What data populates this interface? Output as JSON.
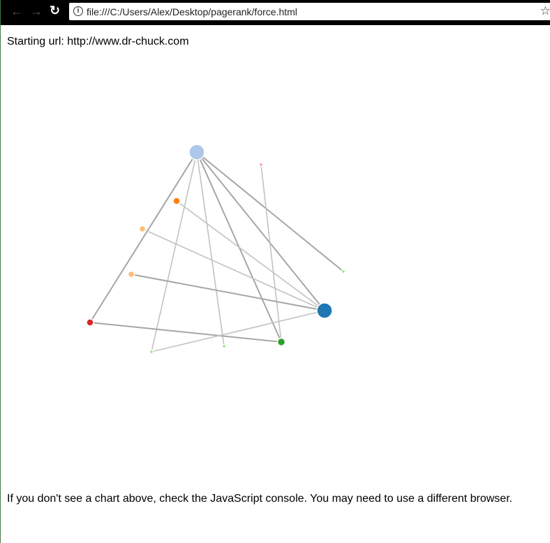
{
  "browser": {
    "url": "file:///C:/Users/Alex/Desktop/pagerank/force.html",
    "back_icon": "arrow-left-icon",
    "forward_icon": "arrow-right-icon",
    "reload_icon": "reload-icon",
    "info_icon": "info-icon",
    "bookmark_icon": "star-icon"
  },
  "page": {
    "starting_url_text": "Starting url: http://www.dr-chuck.com",
    "footer_text": "If you don't see a chart above, check the JavaScript console. You may need to use a different browser."
  },
  "graph": {
    "nodes": [
      {
        "color": "#aec7e8",
        "rank": 11
      },
      {
        "color": "#ff9896",
        "rank": 2.5
      },
      {
        "color": "#ff7f0e",
        "rank": 5
      },
      {
        "color": "#ffbb78",
        "rank": 4.5
      },
      {
        "color": "#ffbb78",
        "rank": 4.5
      },
      {
        "color": "#98df8a",
        "rank": 2.5
      },
      {
        "color": "#1f77b4",
        "rank": 11
      },
      {
        "color": "#d62728",
        "rank": 5
      },
      {
        "color": "#98df8a",
        "rank": 2.5
      },
      {
        "color": "#98df8a",
        "rank": 2.5
      },
      {
        "color": "#2ca02c",
        "rank": 5.5
      }
    ],
    "links": [
      {
        "source": 0,
        "target": 7,
        "strong": true
      },
      {
        "source": 0,
        "target": 8,
        "strong": false
      },
      {
        "source": 0,
        "target": 9,
        "strong": false
      },
      {
        "source": 0,
        "target": 10,
        "strong": true
      },
      {
        "source": 0,
        "target": 6,
        "strong": true
      },
      {
        "source": 0,
        "target": 5,
        "strong": true
      },
      {
        "source": 1,
        "target": 10,
        "strong": false
      },
      {
        "source": 2,
        "target": 6,
        "strong": false
      },
      {
        "source": 3,
        "target": 6,
        "strong": false
      },
      {
        "source": 4,
        "target": 6,
        "strong": true
      },
      {
        "source": 7,
        "target": 10,
        "strong": true
      },
      {
        "source": 8,
        "target": 6,
        "strong": false
      }
    ]
  }
}
